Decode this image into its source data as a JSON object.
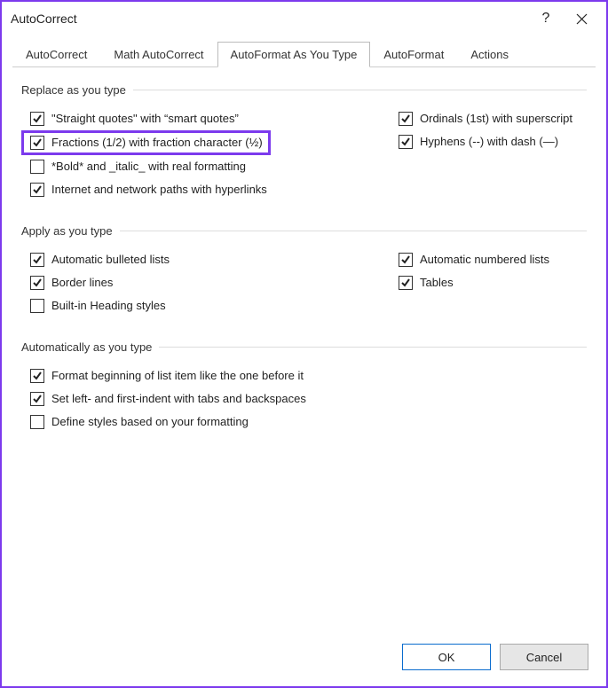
{
  "window": {
    "title": "AutoCorrect",
    "help_symbol": "?"
  },
  "tabs": [
    {
      "label": "AutoCorrect",
      "active": false
    },
    {
      "label": "Math AutoCorrect",
      "active": false
    },
    {
      "label": "AutoFormat As You Type",
      "active": true
    },
    {
      "label": "AutoFormat",
      "active": false
    },
    {
      "label": "Actions",
      "active": false
    }
  ],
  "groups": [
    {
      "title": "Replace as you type",
      "left": [
        {
          "label": "\"Straight quotes\" with “smart quotes”",
          "checked": true,
          "highlight": false
        },
        {
          "label": "Fractions (1/2) with fraction character (½)",
          "checked": true,
          "highlight": true
        },
        {
          "label": "*Bold* and _italic_ with real formatting",
          "checked": false,
          "highlight": false
        },
        {
          "label": "Internet and network paths with hyperlinks",
          "checked": true,
          "highlight": false
        }
      ],
      "right": [
        {
          "label": "Ordinals (1st) with superscript",
          "checked": true
        },
        {
          "label": "Hyphens (--) with dash (—)",
          "checked": true
        }
      ]
    },
    {
      "title": "Apply as you type",
      "left": [
        {
          "label": "Automatic bulleted lists",
          "checked": true
        },
        {
          "label": "Border lines",
          "checked": true
        },
        {
          "label": "Built-in Heading styles",
          "checked": false
        }
      ],
      "right": [
        {
          "label": "Automatic numbered lists",
          "checked": true
        },
        {
          "label": "Tables",
          "checked": true
        }
      ]
    },
    {
      "title": "Automatically as you type",
      "left": [
        {
          "label": "Format beginning of list item like the one before it",
          "checked": true
        },
        {
          "label": "Set left- and first-indent with tabs and backspaces",
          "checked": true
        },
        {
          "label": "Define styles based on your formatting",
          "checked": false
        }
      ],
      "right": []
    }
  ],
  "buttons": {
    "ok": "OK",
    "cancel": "Cancel"
  }
}
